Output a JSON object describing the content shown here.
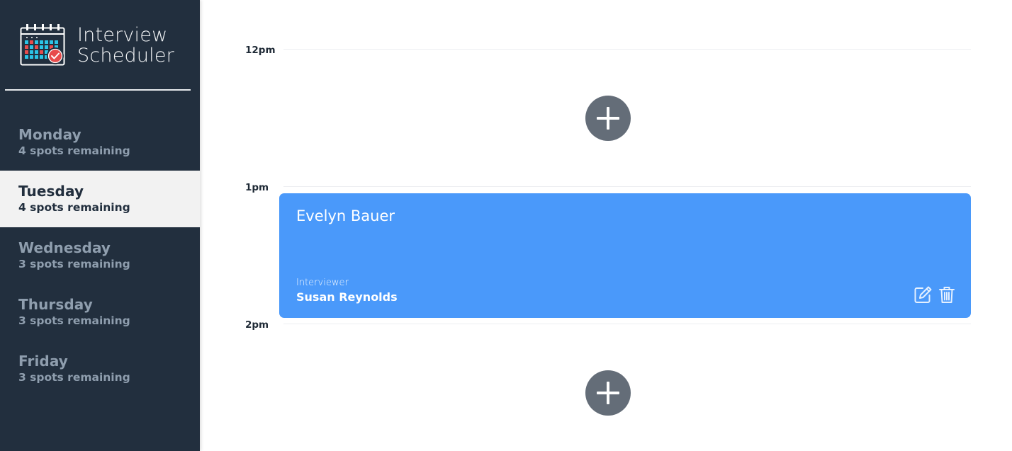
{
  "brand": {
    "line1": "Interview",
    "line2": "Scheduler",
    "logo_icon": "calendar-check-icon",
    "colors": {
      "grid_red": "#e74c4c",
      "grid_cyan": "#2bc4e6",
      "check_badge": "#e74c4c"
    }
  },
  "sidebar": {
    "days": [
      {
        "name": "Monday",
        "spots": "4 spots remaining",
        "selected": false
      },
      {
        "name": "Tuesday",
        "spots": "4 spots remaining",
        "selected": true
      },
      {
        "name": "Wednesday",
        "spots": "3 spots remaining",
        "selected": false
      },
      {
        "name": "Thursday",
        "spots": "3 spots remaining",
        "selected": false
      },
      {
        "name": "Friday",
        "spots": "3 spots remaining",
        "selected": false
      }
    ],
    "colors": {
      "background": "#222f3e",
      "selected_background": "#f2f2f2",
      "muted_text": "#8f9eae"
    }
  },
  "schedule": {
    "times": [
      "12pm",
      "1pm",
      "2pm"
    ],
    "add_icon": "plus-icon",
    "appointment": {
      "student": "Evelyn Bauer",
      "interviewer_label": "Interviewer",
      "interviewer_name": "Susan Reynolds",
      "edit_icon": "edit-icon",
      "delete_icon": "trash-icon",
      "color": "#4a99fa"
    }
  }
}
